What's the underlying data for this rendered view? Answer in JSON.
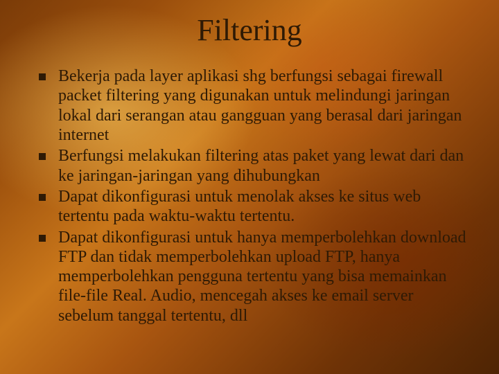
{
  "title": "Filtering",
  "bullets": [
    "Bekerja pada layer aplikasi shg berfungsi sebagai firewall packet filtering yang digunakan untuk melindungi jaringan lokal dari serangan atau gangguan yang berasal dari jaringan internet",
    "Berfungsi melakukan filtering atas paket yang lewat dari dan ke jaringan-jaringan yang dihubungkan",
    "Dapat dikonfigurasi untuk menolak akses ke situs web tertentu pada waktu-waktu tertentu.",
    "Dapat dikonfigurasi untuk hanya memperbolehkan download FTP dan tidak memperbolehkan upload FTP, hanya memperbolehkan pengguna tertentu yang bisa memainkan file-file Real. Audio, mencegah akses ke email server sebelum tanggal tertentu, dll"
  ]
}
